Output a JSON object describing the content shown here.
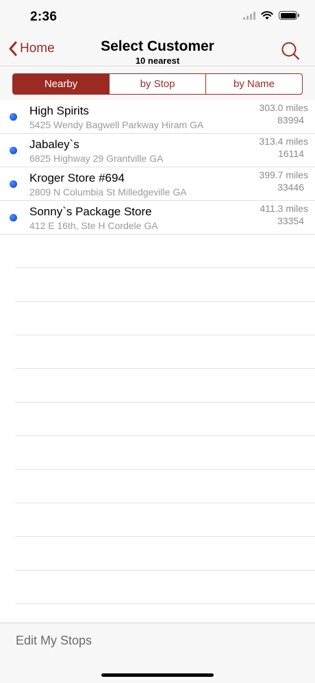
{
  "status_bar": {
    "time": "2:36",
    "icons": [
      "signal-icon",
      "wifi-icon",
      "battery-icon"
    ]
  },
  "nav": {
    "back_label": "Home",
    "title": "Select Customer",
    "subtitle": "10 nearest",
    "search_icon": "search-icon"
  },
  "segments": [
    {
      "label": "Nearby",
      "selected": true
    },
    {
      "label": "by Stop",
      "selected": false
    },
    {
      "label": "by Name",
      "selected": false
    }
  ],
  "customers": [
    {
      "name": "High Spirits",
      "address": "5425 Wendy Bagwell Parkway Hiram GA",
      "distance": "303.0 miles",
      "zip": "83994"
    },
    {
      "name": "Jabaley`s",
      "address": "6825 Highway 29 Grantville GA",
      "distance": "313.4 miles",
      "zip": "16114"
    },
    {
      "name": "Kroger Store #694",
      "address": "2809 N Columbia St Milledgeville GA",
      "distance": "399.7 miles",
      "zip": "33446"
    },
    {
      "name": "Sonny`s Package Store",
      "address": "412 E 16th, Ste H Cordele GA",
      "distance": "411.3 miles",
      "zip": "33354"
    }
  ],
  "toolbar": {
    "edit_label": "Edit My Stops"
  },
  "colors": {
    "accent": "#9b2b22",
    "dot": "#1a5fe0",
    "bar_background": "#f7f7f7"
  }
}
